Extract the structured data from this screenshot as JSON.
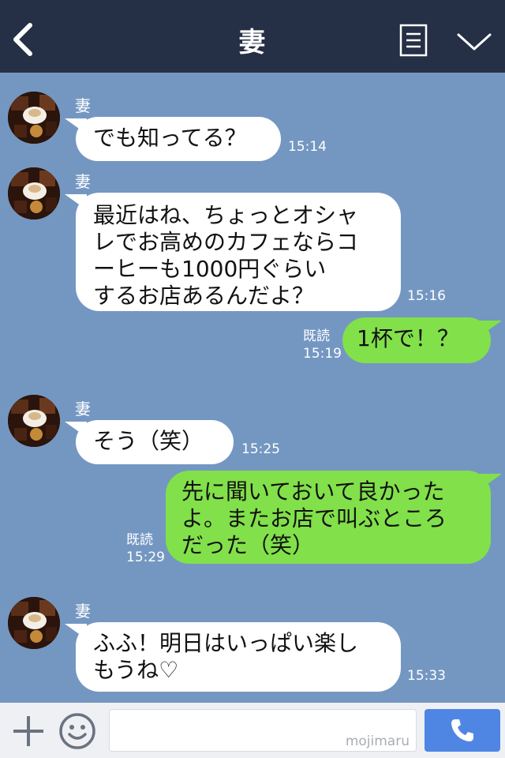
{
  "header": {
    "title": "妻",
    "back_icon": "chevron-left-icon",
    "menu_icon": "menu-list-icon",
    "collapse_icon": "chevron-down-icon"
  },
  "messages": [
    {
      "side": "left",
      "sender": "妻",
      "text": "でも知ってる？",
      "time": "15:14"
    },
    {
      "side": "left",
      "sender": "妻",
      "text_lines": [
        "最近はね、ちょっとオシャ",
        "レでお高めのカフェならコ",
        "ーヒーも1000円ぐらい",
        "するお店あるんだよ？"
      ],
      "time": "15:16"
    },
    {
      "side": "right",
      "text": "1杯で！？",
      "read": "既読",
      "time": "15:19"
    },
    {
      "side": "left",
      "sender": "妻",
      "text": "そう（笑）",
      "time": "15:25"
    },
    {
      "side": "right",
      "text_lines": [
        "先に聞いておいて良かった",
        "よ。またお店で叫ぶところ",
        "だった（笑）"
      ],
      "read": "既読",
      "time": "15:29"
    },
    {
      "side": "left",
      "sender": "妻",
      "text_lines": [
        "ふふ！明日はいっぱい楽し",
        "もうね♡"
      ],
      "time": "15:33"
    }
  ],
  "input": {
    "placeholder": "",
    "watermark": "mojimaru",
    "plus_icon": "plus-icon",
    "emoji_icon": "smile-icon",
    "send_icon": "phone-icon"
  },
  "colors": {
    "header_bg": "#252f45",
    "chat_bg": "#7497c2",
    "left_bubble": "#ffffff",
    "right_bubble": "#82e04a",
    "send_button": "#4f86e3"
  }
}
